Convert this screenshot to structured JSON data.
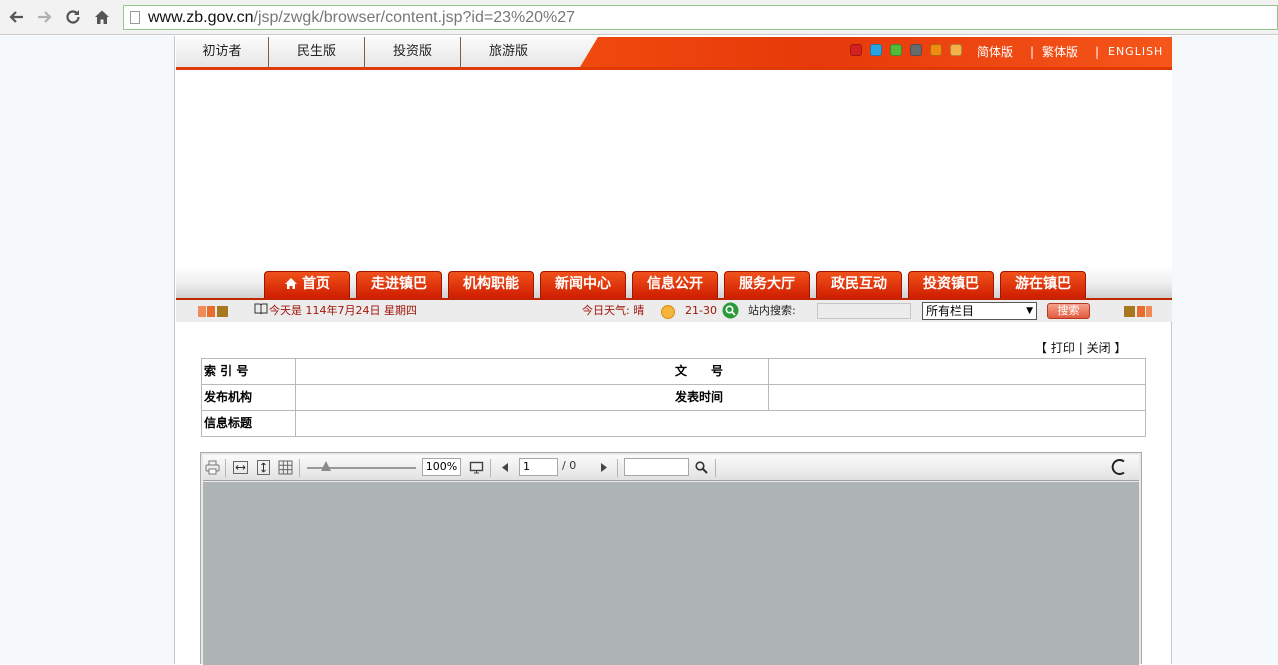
{
  "browser": {
    "url_host": "www.zb.gov.cn",
    "url_path": "/jsp/zwgk/browser/content.jsp?id=23%20%27"
  },
  "topbar": {
    "links": [
      "初访者",
      "民生版",
      "投资版",
      "旅游版"
    ],
    "theme_colors": [
      "#d42020",
      "#2aa3e0",
      "#53b93a",
      "#6a6a6a",
      "#f08c12",
      "#f5b24a"
    ],
    "lang_simplified": "简体版",
    "lang_traditional": "繁体版",
    "lang_english": "ENGLISH",
    "lang_sep": "|"
  },
  "nav": {
    "tabs": [
      "首页",
      "走进镇巴",
      "机构职能",
      "新闻中心",
      "信息公开",
      "服务大厅",
      "政民互动",
      "投资镇巴",
      "游在镇巴"
    ]
  },
  "info": {
    "date": "今天是 114年7月24日 星期四",
    "weather_label": "今日天气: 晴",
    "temperature": "21-30",
    "search_label": "站内搜索:",
    "category_selected": "所有栏目",
    "search_button": "搜索"
  },
  "actions": {
    "open_bracket": "【",
    "print": "打印",
    "sep": "|",
    "close": "关闭",
    "close_bracket": "】"
  },
  "meta": {
    "index_label": "索 引 号",
    "doc_no_label": "文　　号",
    "publisher_label": "发布机构",
    "publish_time_label": "发表时间",
    "title_label": "信息标题"
  },
  "viewer": {
    "zoom": "100%",
    "page": "1",
    "page_total": "/ 0"
  }
}
